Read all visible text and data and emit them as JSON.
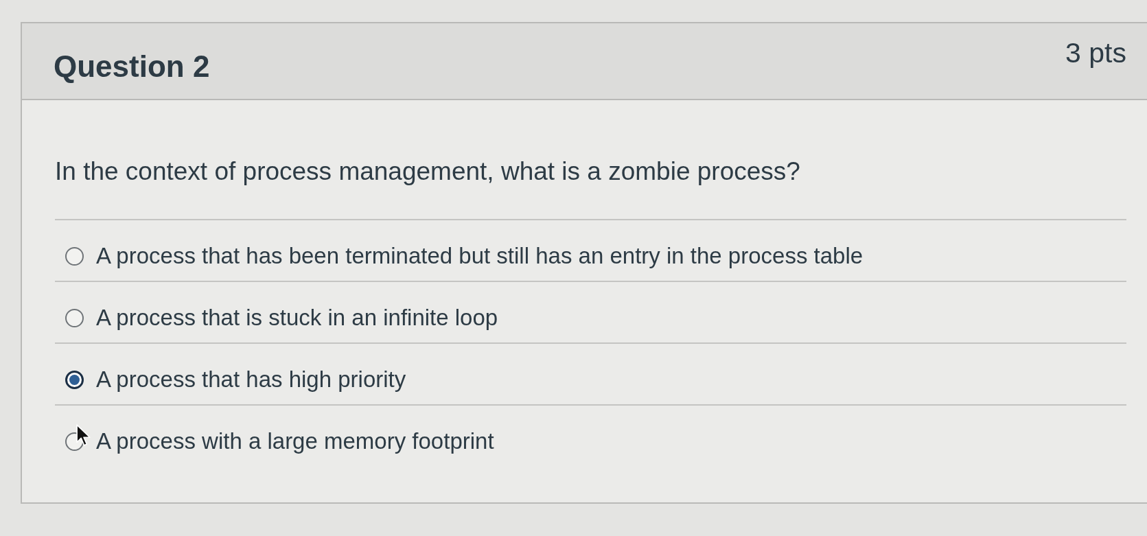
{
  "question": {
    "title": "Question 2",
    "points": "3 pts",
    "text": "In the context of process management, what is a zombie process?"
  },
  "answers": [
    {
      "label": "A process that has been terminated but still has an entry in the process table",
      "selected": false,
      "hovered": false
    },
    {
      "label": "A process that is stuck in an infinite loop",
      "selected": false,
      "hovered": false
    },
    {
      "label": "A process that has high priority",
      "selected": true,
      "hovered": false
    },
    {
      "label": "A process with a large memory footprint",
      "selected": false,
      "hovered": true
    }
  ]
}
